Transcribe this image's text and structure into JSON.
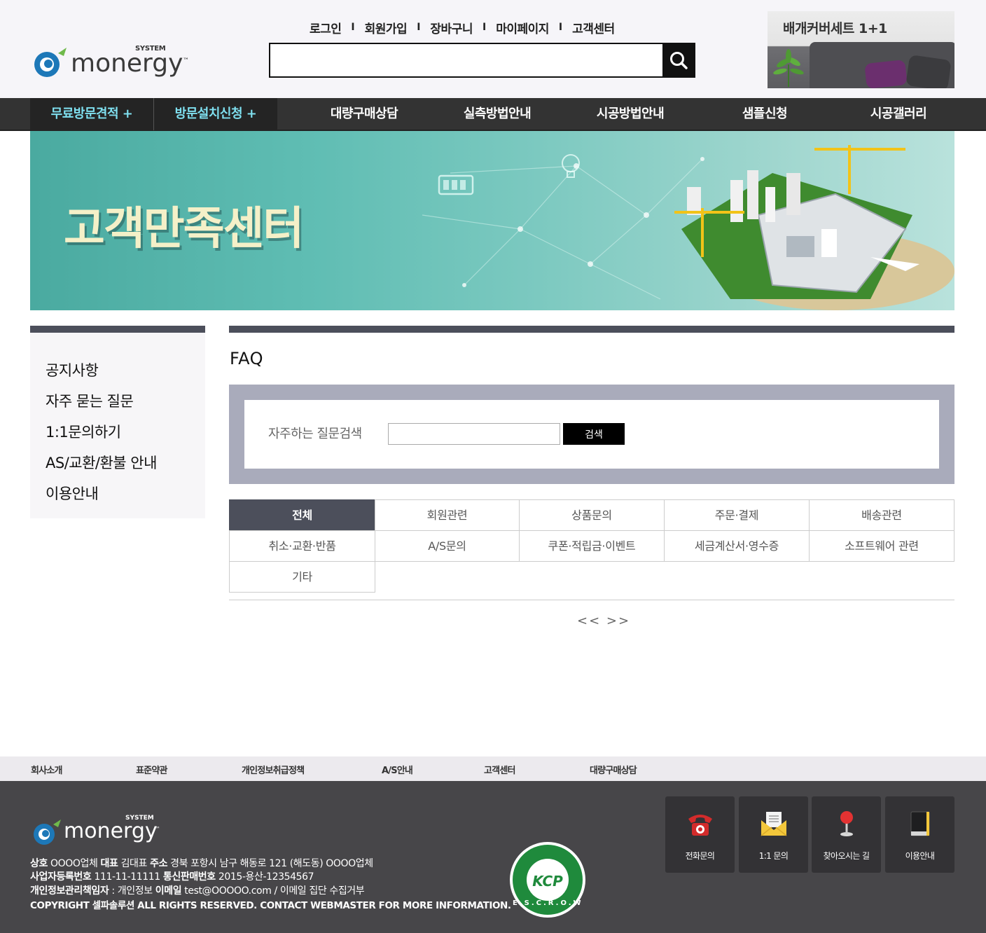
{
  "header": {
    "logo": {
      "system": "SYSTEM",
      "word": "monergy",
      "tm": "™"
    },
    "top_links": [
      "로그인",
      "회원가입",
      "장바구니",
      "마이페이지",
      "고객센터"
    ],
    "separator": "I",
    "search": {
      "placeholder": "",
      "value": ""
    },
    "promo": {
      "text": "배개커버세트 1+1"
    }
  },
  "nav": {
    "items": [
      "무료방문견적 +",
      "방문설치신청 +",
      "대량구매상담",
      "실측방법안내",
      "시공방법안내",
      "샘플신청",
      "시공갤러리"
    ]
  },
  "banner": {
    "title": "고객만족센터"
  },
  "sidebar": {
    "items": [
      "공지사항",
      "자주 묻는 질문",
      "1:1문의하기",
      "AS/교환/환불 안내",
      "이용안내"
    ]
  },
  "content": {
    "title": "FAQ",
    "search_label": "자주하는 질문검색",
    "search_value": "",
    "search_button": "검색",
    "categories": [
      "전체",
      "회원관련",
      "상품문의",
      "주문·결제",
      "배송관련",
      "취소·교환·반품",
      "A/S문의",
      "쿠폰·적립금·이벤트",
      "세금계산서·영수증",
      "소프트웨어 관련",
      "기타"
    ],
    "active_category": "전체",
    "pager": "<< >>"
  },
  "footer": {
    "links": [
      "회사소개",
      "표준약관",
      "개인정보취급정책",
      "A/S안내",
      "고객센터",
      "대량구매상담"
    ],
    "logo": {
      "system": "SYSTEM",
      "word": "monergy",
      "tm": "™"
    },
    "line1": {
      "k1": "상호",
      "v1": "OOOO업체",
      "k2": "대표",
      "v2": "김대표",
      "k3": "주소",
      "v3": "경북 포항시 남구 해동로 121 (해도동) OOOO업체"
    },
    "line2": {
      "k1": "사업자등록번호",
      "v1": "111-11-11111",
      "k2": "통신판매번호",
      "v2": "2015-용산-12354567"
    },
    "line3": {
      "k1": "개인정보관리책임자",
      "v1": ": 개인정보",
      "k2": "이메일",
      "v2": "test@OOOOO.com / 이메일 집단 수집거부"
    },
    "copyright": "COPYRIGHT 셀파솔루션 ALL RIGHTS RESERVED. CONTACT WEBMASTER FOR MORE INFORMATION.",
    "kcp": {
      "text": "KCP",
      "ring": "E.S.C.R.O.W"
    },
    "quick": [
      "전화문의",
      "1:1 문의",
      "찾아오시는 길",
      "이용안내"
    ]
  },
  "colors": {
    "nav_bg": "#333333",
    "nav_highlight_text": "#7fe0f0",
    "accent_dark": "#4c4f5b",
    "footer_bg": "#474649",
    "kcp_green": "#1f8a3c"
  },
  "icons": [
    "search-icon",
    "telephone-icon",
    "envelope-icon",
    "map-pin-icon",
    "book-icon"
  ]
}
